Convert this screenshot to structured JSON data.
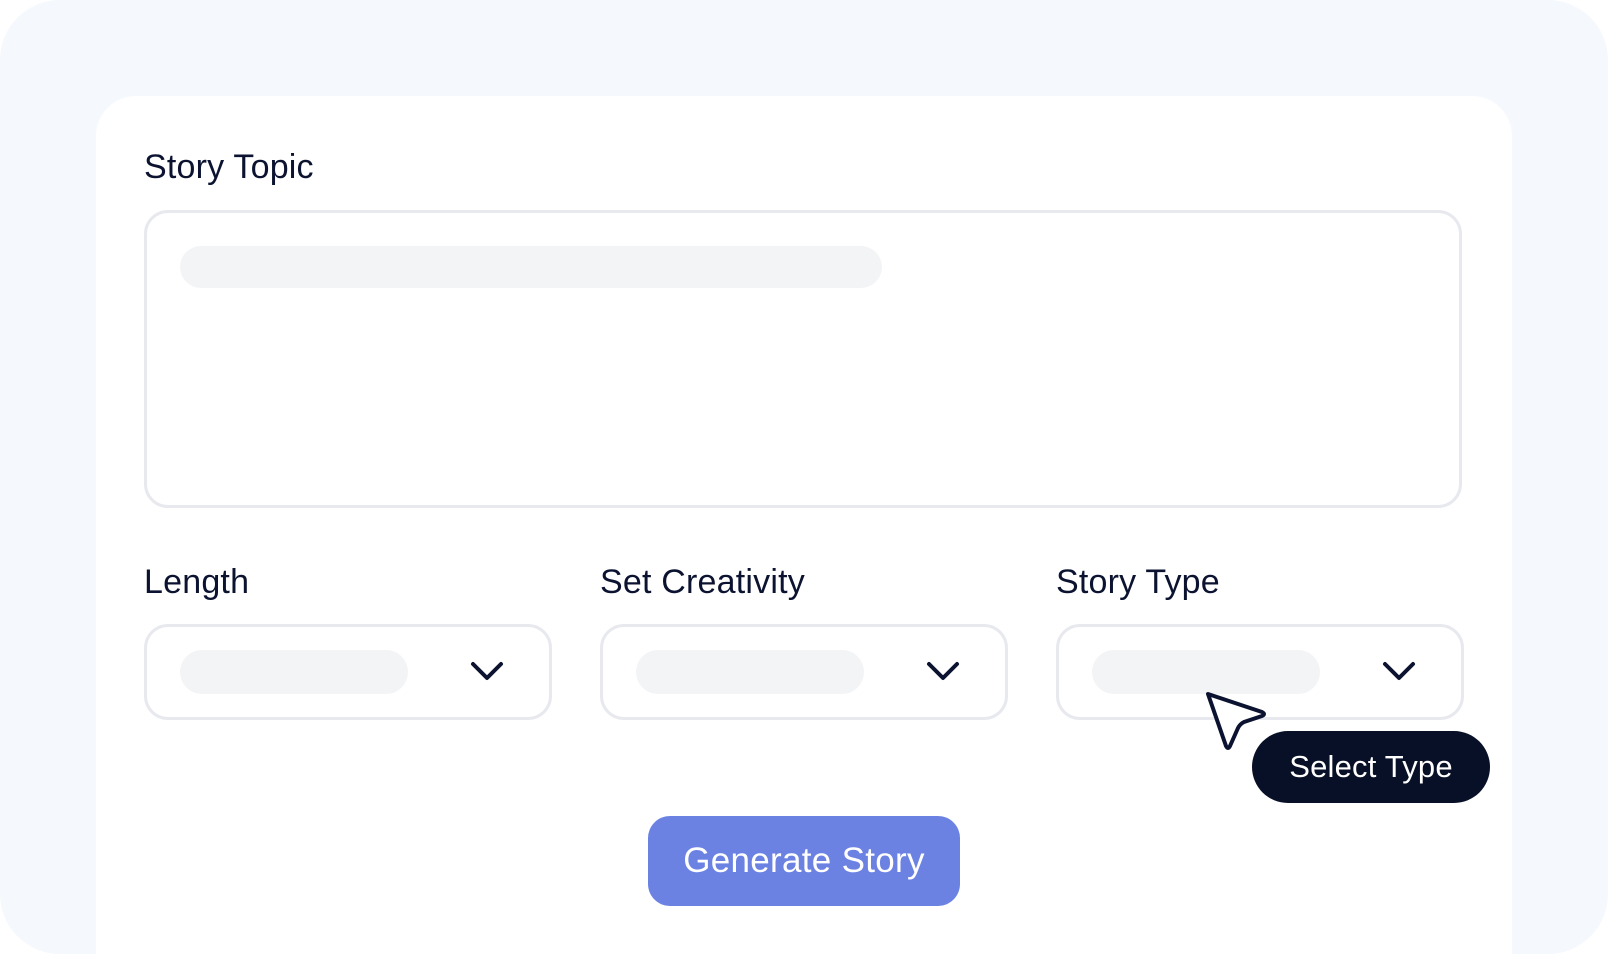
{
  "form": {
    "topic_label": "Story Topic",
    "length_label": "Length",
    "creativity_label": "Set Creativity",
    "type_label": "Story Type",
    "generate_label": "Generate Story",
    "tooltip_text": "Select Type"
  },
  "icons": {
    "dropdown": "chevron-down-icon",
    "pointer": "cursor-arrow-icon"
  },
  "colors": {
    "primary_button": "#6b82e3",
    "tooltip_bg": "#081027",
    "text": "#0b1330",
    "border": "#e7e9ee",
    "skeleton": "#f3f4f6"
  }
}
